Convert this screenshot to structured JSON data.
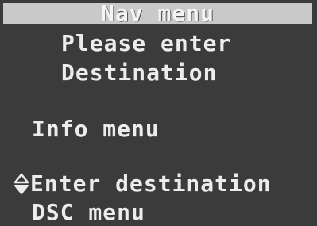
{
  "header": {
    "title": "Nav menu"
  },
  "prompt": {
    "line1": "Please enter",
    "line2": "Destination"
  },
  "menu": {
    "items": [
      {
        "label": "Info menu"
      },
      {
        "label": "Enter destination",
        "selected": true
      },
      {
        "label": "DSC menu"
      }
    ]
  },
  "icons": {
    "selection_indicator": "up-down-scroll-icon"
  },
  "colors": {
    "screen_background": "#3b3b3b",
    "header_bar": "#c9c9c9",
    "text": "#ececec"
  }
}
